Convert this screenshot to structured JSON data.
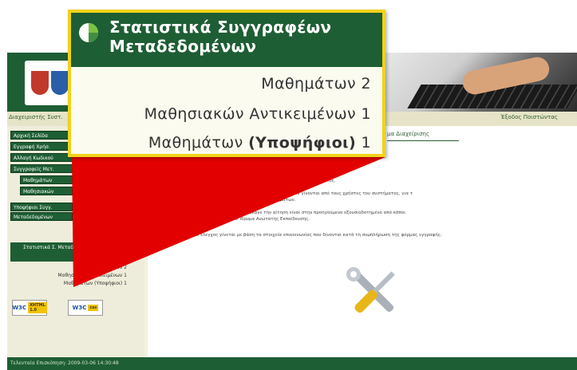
{
  "header": {
    "subbar_left": "Διαχειριστής Συστ.",
    "subbar_right": "Έξοδος Ποιστώντας"
  },
  "sidebar": {
    "items": [
      "Αρχική Σελίδα",
      "Εγγραφή Χρήσ.",
      "Αλλαγή Κωδικού",
      "Συγγραφείς Μετ.",
      "Μαθημάτων",
      "Μαθησιακών",
      "Υποψήφιοι Συγγ.",
      "Μεταδεδομένων"
    ],
    "panel_head": "Στατιστικά Σ. Μεταδεδομ.",
    "panel_lines": [
      {
        "text": "Μαθημάτων",
        "count": "2"
      },
      {
        "text": "Μαθησιακών Αντικειμένων",
        "count": "1"
      },
      {
        "text": "Μαθημάτων (Υποψήφιοι)",
        "count": "1"
      }
    ],
    "badges": [
      {
        "name": "W3C",
        "tag": "XHTML 1.0"
      },
      {
        "name": "W3C",
        "tag": "css"
      }
    ]
  },
  "content": {
    "title": "μα Διαχείρισης",
    "lines": [
      "ματικά αυθεντικ για τη σωστή λειτουργία του συστήματος.",
      "ανού έχει είναι ο έλεγχος τις ενέργειες που γίνονται από τους χρήστες του συστήματος, για τ",
      "Συγγραφείς Μεταδεδομένων Μαθημάτων.",
      "ρα να τηρήσουν που έκανε την αίτηση είναι στην προηγούμενο εξουσιοδοτημένο από κάποι",
      "αναγνωρισμένο Ίδρυμα Ανώτατης Εκπαίδευσης.",
      "Ο έλεγχος γίνεται με βάση τα στοιχεία επικοινωνίας που δίνονται κατά τη συμπλήρωση της φόρμας εγγραφής."
    ]
  },
  "footer": {
    "text": "Τελευταία Επισκόπηση: 2009-03-06 14:30:48"
  },
  "callout": {
    "title_line1": "Στατιστικά Συγγραφέων",
    "title_line2": "Μεταδεδομένων",
    "line1_text": "Μαθημάτων",
    "line1_count": "2",
    "line2_text": "Μαθησιακών Αντικειμένων",
    "line2_count": "1",
    "line3_text": "Μαθημάτων",
    "line3_bold": "(Υποψήφιοι)",
    "line3_count": "1"
  },
  "colors": {
    "header_green": "#1e5e34",
    "callout_border": "#f2d21a",
    "pointer_red": "#e30000"
  }
}
